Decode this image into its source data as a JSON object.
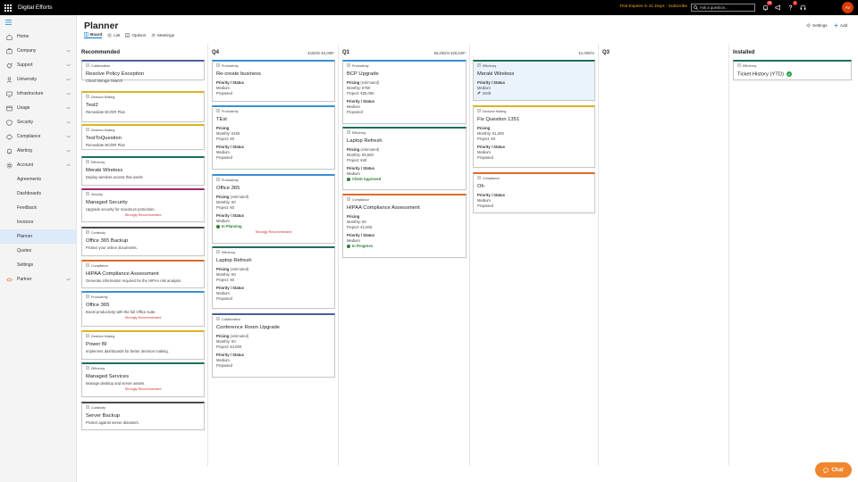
{
  "app": {
    "title": "Digital Efforts",
    "trial": "Trial Expires in 21 Days - Subscribe",
    "search_placeholder": "Ask a question...",
    "notif_count": "45",
    "help_count": "3",
    "avatar_initials": "AV"
  },
  "sidebar": {
    "items": [
      {
        "label": "Home",
        "icon": "home-icon"
      },
      {
        "label": "Company",
        "icon": "company-icon",
        "expandable": true
      },
      {
        "label": "Support",
        "icon": "support-icon",
        "expandable": true
      },
      {
        "label": "University",
        "icon": "university-icon",
        "expandable": true
      },
      {
        "label": "Infrastructure",
        "icon": "infrastructure-icon",
        "expandable": true
      },
      {
        "label": "Usage",
        "icon": "usage-icon",
        "expandable": true
      },
      {
        "label": "Security",
        "icon": "security-icon",
        "expandable": true
      },
      {
        "label": "Compliance",
        "icon": "compliance-icon",
        "expandable": true
      },
      {
        "label": "Alerting",
        "icon": "bell-icon",
        "expandable": true
      },
      {
        "label": "Account",
        "icon": "gear-icon",
        "expandable": true,
        "expanded": true
      },
      {
        "label": "Agreements",
        "sub": true
      },
      {
        "label": "Dashboards",
        "sub": true
      },
      {
        "label": "Feedback",
        "sub": true
      },
      {
        "label": "Invoices",
        "sub": true
      },
      {
        "label": "Planner",
        "sub": true,
        "active": true
      },
      {
        "label": "Quotes",
        "sub": true
      },
      {
        "label": "Settings",
        "sub": true
      },
      {
        "label": "Partner",
        "icon": "partner-icon",
        "expandable": true
      }
    ]
  },
  "page": {
    "title": "Planner",
    "tabs": [
      {
        "label": "Board",
        "icon": "board-icon",
        "active": true
      },
      {
        "label": "List",
        "icon": "list-icon"
      },
      {
        "label": "Options",
        "icon": "options-icon"
      },
      {
        "label": "Meetings",
        "icon": "meetings-icon"
      }
    ],
    "settings_label": "Settings",
    "add_label": "Add"
  },
  "columns": [
    {
      "name": "Recommended",
      "summary": "",
      "cards": [
        {
          "category": "Collaboration",
          "cat": "collab",
          "title": "Resolve Policy Exception",
          "desc": "Cloud Storage Search"
        },
        {
          "category": "Decision Making",
          "cat": "decision",
          "title": "Test2",
          "desc": "Remediate BC/DR Plan"
        },
        {
          "category": "Decision Making",
          "cat": "decision",
          "title": "TestToQuestion",
          "desc": "Remediate BC/DR Plan"
        },
        {
          "category": "Efficiency",
          "cat": "eff",
          "title": "Meraki Wireless",
          "desc": "Deploy wireless access that works"
        },
        {
          "category": "Security",
          "cat": "sec",
          "title": "Managed Security",
          "desc": "Upgrade security for maximum protection.",
          "strong": "Strongly Recommended"
        },
        {
          "category": "Continuity",
          "cat": "cont",
          "title": "Office 365 Backup",
          "desc": "Protect your online documents."
        },
        {
          "category": "Compliance",
          "cat": "comp",
          "title": "HIPAA Compliance Assessment",
          "desc": "Generate information required for the HIPAA risk analysis."
        },
        {
          "category": "Productivity",
          "cat": "prod",
          "title": "Office 365",
          "desc": "Boost productivity with the full Office suite.",
          "strong": "Strongly Recommended"
        },
        {
          "category": "Decision Making",
          "cat": "decision",
          "title": "Power BI",
          "desc": "Implement dashboards for better decision making."
        },
        {
          "category": "Efficiency",
          "cat": "eff",
          "title": "Managed Services",
          "desc": "Manage desktop and server assets.",
          "strong": "Strongly Recommended"
        },
        {
          "category": "Continuity",
          "cat": "cont",
          "title": "Server Backup",
          "desc": "Protect against server disasters."
        }
      ]
    },
    {
      "name": "Q4",
      "summary": "€150/m  €4,000*",
      "cards": [
        {
          "category": "Productivity",
          "cat": "prod",
          "title": "Re-create business",
          "ps_label": "Priority / Status",
          "priority": "Medium",
          "status": "Proposed"
        },
        {
          "category": "Productivity",
          "cat": "prod",
          "title": "TEst",
          "pricing_label": "Pricing",
          "monthly": "Monthly: €100",
          "project": "Project: €0",
          "ps_label": "Priority / Status",
          "priority": "Medium",
          "status": "Proposed"
        },
        {
          "category": "Productivity",
          "cat": "prod",
          "title": "Office 365",
          "pricing_label": "Pricing",
          "est": "(estimated)",
          "monthly": "Monthly: €0",
          "project": "Project: €0",
          "ps_label": "Priority / Status",
          "priority": "Medium",
          "status": "In Planning",
          "status_dot": true,
          "strong": "Strongly Recommended"
        },
        {
          "category": "Efficiency",
          "cat": "eff",
          "title": "Laptop Refresh",
          "pricing_label": "Pricing",
          "est": "(estimated)",
          "monthly": "Monthly: €0",
          "project": "Project: €0",
          "ps_label": "Priority / Status",
          "priority": "Medium",
          "status": "Proposed"
        },
        {
          "category": "Collaboration",
          "cat": "collab",
          "title": "Conference Room Upgrade",
          "pricing_label": "Pricing",
          "est": "(estimated)",
          "monthly": "Monthly: €0",
          "project": "Project: €4,000",
          "ps_label": "Priority / Status",
          "priority": "Medium",
          "status": "Proposed"
        }
      ]
    },
    {
      "name": "Q1",
      "summary": "€6,250/m  €26,640*",
      "cards": [
        {
          "category": "Productivity",
          "cat": "prod",
          "title": "BCP Upgrade",
          "pricing_label": "Pricing",
          "est": "(estimated)",
          "monthly": "Monthly: €750",
          "project": "Project: €25,000",
          "ps_label": "Priority / Status",
          "priority": "Medium",
          "status": "Proposed"
        },
        {
          "category": "Efficiency",
          "cat": "eff",
          "title": "Laptop Refresh",
          "pricing_label": "Pricing",
          "est": "(estimated)",
          "monthly": "Monthly: €5,500",
          "project": "Project: €40",
          "ps_label": "Priority / Status",
          "priority": "Medium",
          "status": "Client Approved",
          "status_dot": true
        },
        {
          "category": "Compliance",
          "cat": "comp",
          "title": "HIPAA Compliance Assessment",
          "pricing_label": "Pricing",
          "monthly": "Monthly: €0",
          "project": "Project: €1,000",
          "ps_label": "Priority / Status",
          "priority": "Medium",
          "status": "In Progress",
          "status_dot": true
        }
      ]
    },
    {
      "name": "",
      "summary": "€1,000/m",
      "cards": [
        {
          "category": "Efficiency",
          "cat": "eff",
          "title": "Meraki Wireless",
          "selected": true,
          "ps_label": "Priority / Status",
          "priority": "Medium",
          "status": "Draft",
          "draft": true
        },
        {
          "category": "Decision Making",
          "cat": "decision",
          "title": "Fix Question 1351",
          "pricing_label": "Pricing",
          "monthly": "Monthly: €1,000",
          "project": "Project: €0",
          "ps_label": "Priority / Status",
          "priority": "Medium",
          "status": "Proposed"
        },
        {
          "category": "Compliance",
          "cat": "comp",
          "title": "Oh",
          "ps_label": "Priority / Status",
          "priority": "Medium",
          "status": "Proposed"
        }
      ]
    },
    {
      "name": "Q3",
      "summary": "",
      "cards": []
    },
    {
      "name": "Installed",
      "summary": "",
      "cards": [
        {
          "category": "Efficiency",
          "cat": "eff",
          "title": "Ticket History (YTD)",
          "installed_check": true
        }
      ]
    }
  ],
  "chat_label": "Chat",
  "colors": {
    "accent": "#0078d4",
    "trial": "#f5a623",
    "avatar": "#d83b01",
    "chat": "#f0862e",
    "strong": "#d32f2f",
    "status_green": "#2e7d32"
  }
}
